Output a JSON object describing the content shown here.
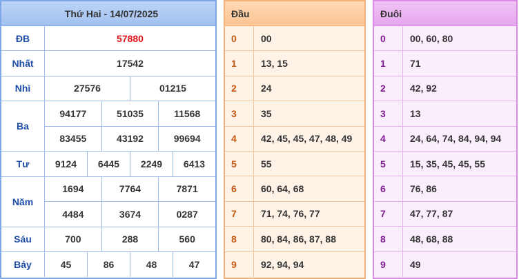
{
  "results": {
    "title": "Thứ Hai - 14/07/2025",
    "prizes": [
      {
        "label": "ĐB",
        "rows": [
          [
            "57880"
          ]
        ],
        "special": true
      },
      {
        "label": "Nhất",
        "rows": [
          [
            "17542"
          ]
        ]
      },
      {
        "label": "Nhì",
        "rows": [
          [
            "27576",
            "01215"
          ]
        ]
      },
      {
        "label": "Ba",
        "rows": [
          [
            "94177",
            "51035",
            "11568"
          ],
          [
            "83455",
            "43192",
            "99694"
          ]
        ]
      },
      {
        "label": "Tư",
        "rows": [
          [
            "9124",
            "6445",
            "2249",
            "6413"
          ]
        ]
      },
      {
        "label": "Năm",
        "rows": [
          [
            "1694",
            "7764",
            "7871"
          ],
          [
            "4484",
            "3674",
            "0287"
          ]
        ]
      },
      {
        "label": "Sáu",
        "rows": [
          [
            "700",
            "288",
            "560"
          ]
        ]
      },
      {
        "label": "Bảy",
        "rows": [
          [
            "45",
            "86",
            "48",
            "47"
          ]
        ]
      }
    ]
  },
  "head": {
    "title": "Đầu",
    "rows": [
      {
        "digit": "0",
        "values": "00"
      },
      {
        "digit": "1",
        "values": "13, 15"
      },
      {
        "digit": "2",
        "values": "24"
      },
      {
        "digit": "3",
        "values": "35"
      },
      {
        "digit": "4",
        "values": "42, 45, 45, 47, 48, 49"
      },
      {
        "digit": "5",
        "values": "55"
      },
      {
        "digit": "6",
        "values": "60, 64, 68"
      },
      {
        "digit": "7",
        "values": "71, 74, 76, 77"
      },
      {
        "digit": "8",
        "values": "80, 84, 86, 87, 88"
      },
      {
        "digit": "9",
        "values": "92, 94, 94"
      }
    ]
  },
  "tail": {
    "title": "Đuôi",
    "rows": [
      {
        "digit": "0",
        "values": "00, 60, 80"
      },
      {
        "digit": "1",
        "values": "71"
      },
      {
        "digit": "2",
        "values": "42, 92"
      },
      {
        "digit": "3",
        "values": "13"
      },
      {
        "digit": "4",
        "values": "24, 64, 74, 84, 94, 94"
      },
      {
        "digit": "5",
        "values": "15, 35, 45, 45, 55"
      },
      {
        "digit": "6",
        "values": "76, 86"
      },
      {
        "digit": "7",
        "values": "47, 77, 87"
      },
      {
        "digit": "8",
        "values": "48, 68, 88"
      },
      {
        "digit": "9",
        "values": "49"
      }
    ]
  },
  "colors": {
    "special": "#e3131b",
    "label_blue": "#1f4ea8",
    "head_digit": "#c5560e",
    "tail_digit": "#7d1b91"
  }
}
